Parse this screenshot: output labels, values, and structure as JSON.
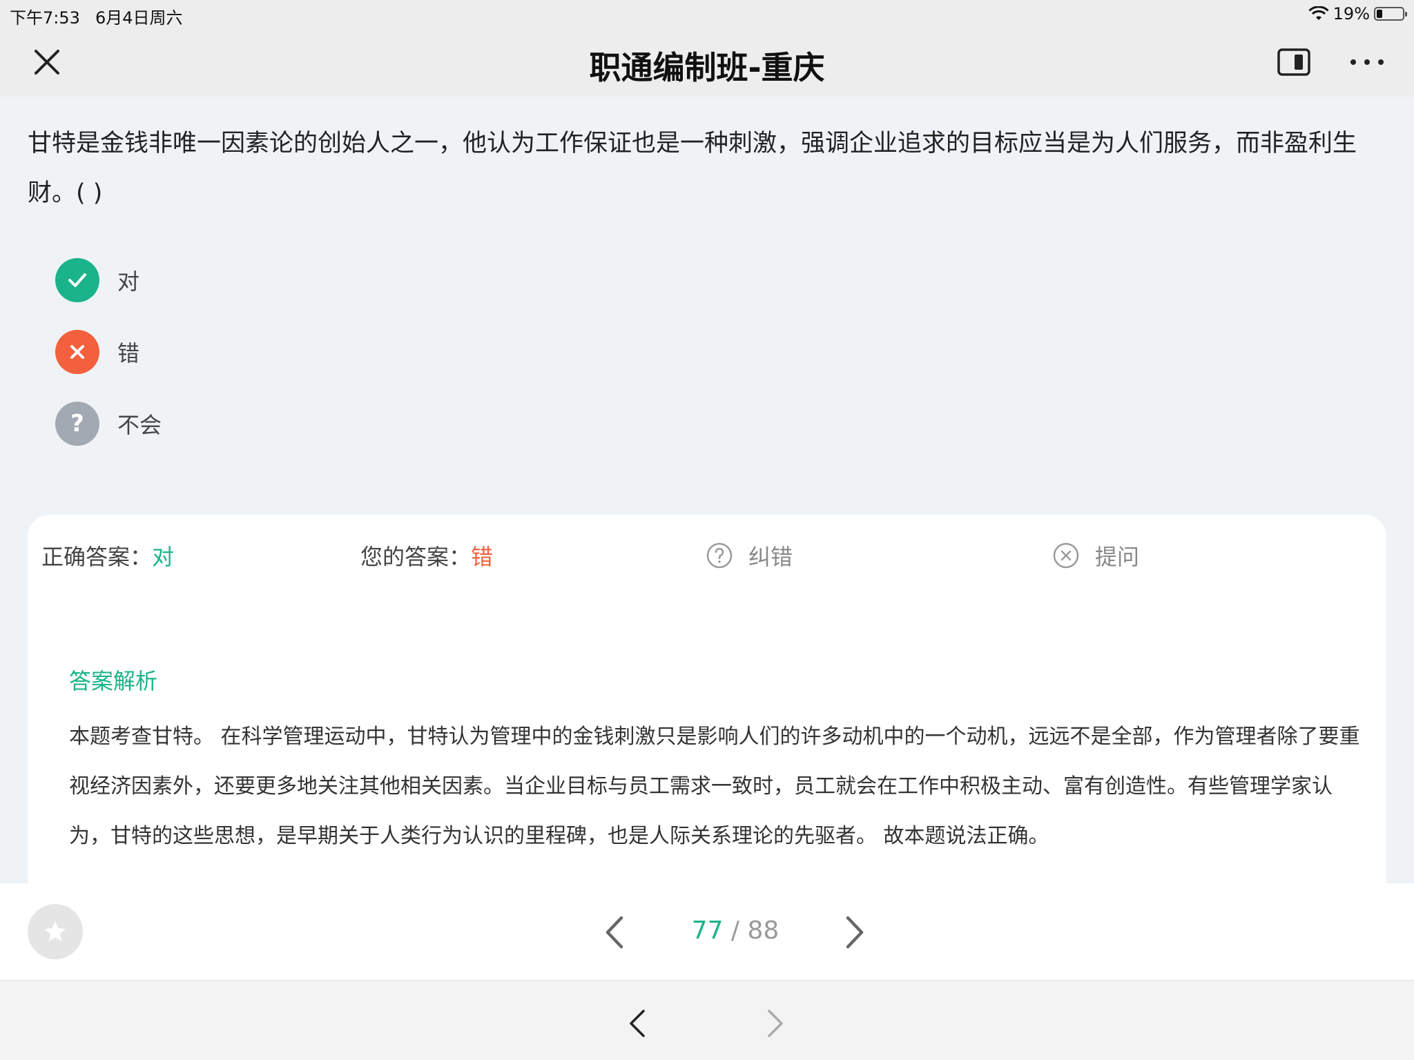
{
  "status_bar": {
    "time": "下午7:53",
    "date": "6月4日周六",
    "battery": "19%"
  },
  "nav": {
    "title": "职通编制班-重庆"
  },
  "question": {
    "text": "甘特是金钱非唯一因素论的创始人之一，他认为工作保证也是一种刺激，强调企业追求的目标应当是为人们服务，而非盈利生财。( )"
  },
  "options": [
    {
      "label": "对",
      "status": "correct",
      "color": "#1bb38a",
      "icon": "check-icon"
    },
    {
      "label": "错",
      "status": "wrong",
      "color": "#f2603d",
      "icon": "close-icon"
    },
    {
      "label": "不会",
      "status": "unknown",
      "color": "#a3a9b3",
      "icon": "question-icon"
    }
  ],
  "answer_bar": {
    "correct_label": "正确答案：",
    "correct_value": "对",
    "your_label": "您的答案：",
    "your_value": "错",
    "report_label": "纠错",
    "ask_label": "提问"
  },
  "analysis": {
    "title": "答案解析",
    "body": "本题考查甘特。 在科学管理运动中，甘特认为管理中的金钱刺激只是影响人们的许多动机中的一个动机，远远不是全部，作为管理者除了要重视经济因素外，还要更多地关注其他相关因素。当企业目标与员工需求一致时，员工就会在工作中积极主动、富有创造性。有些管理学家认为，甘特的这些思想，是早期关于人类行为认识的里程碑，也是人际关系理论的先驱者。 故本题说法正确。"
  },
  "pager": {
    "current": "77",
    "separator": " / ",
    "total": "88"
  },
  "colors": {
    "accent_green": "#1bb38a",
    "accent_red": "#f2603d",
    "neutral_gray": "#a3a9b3"
  }
}
